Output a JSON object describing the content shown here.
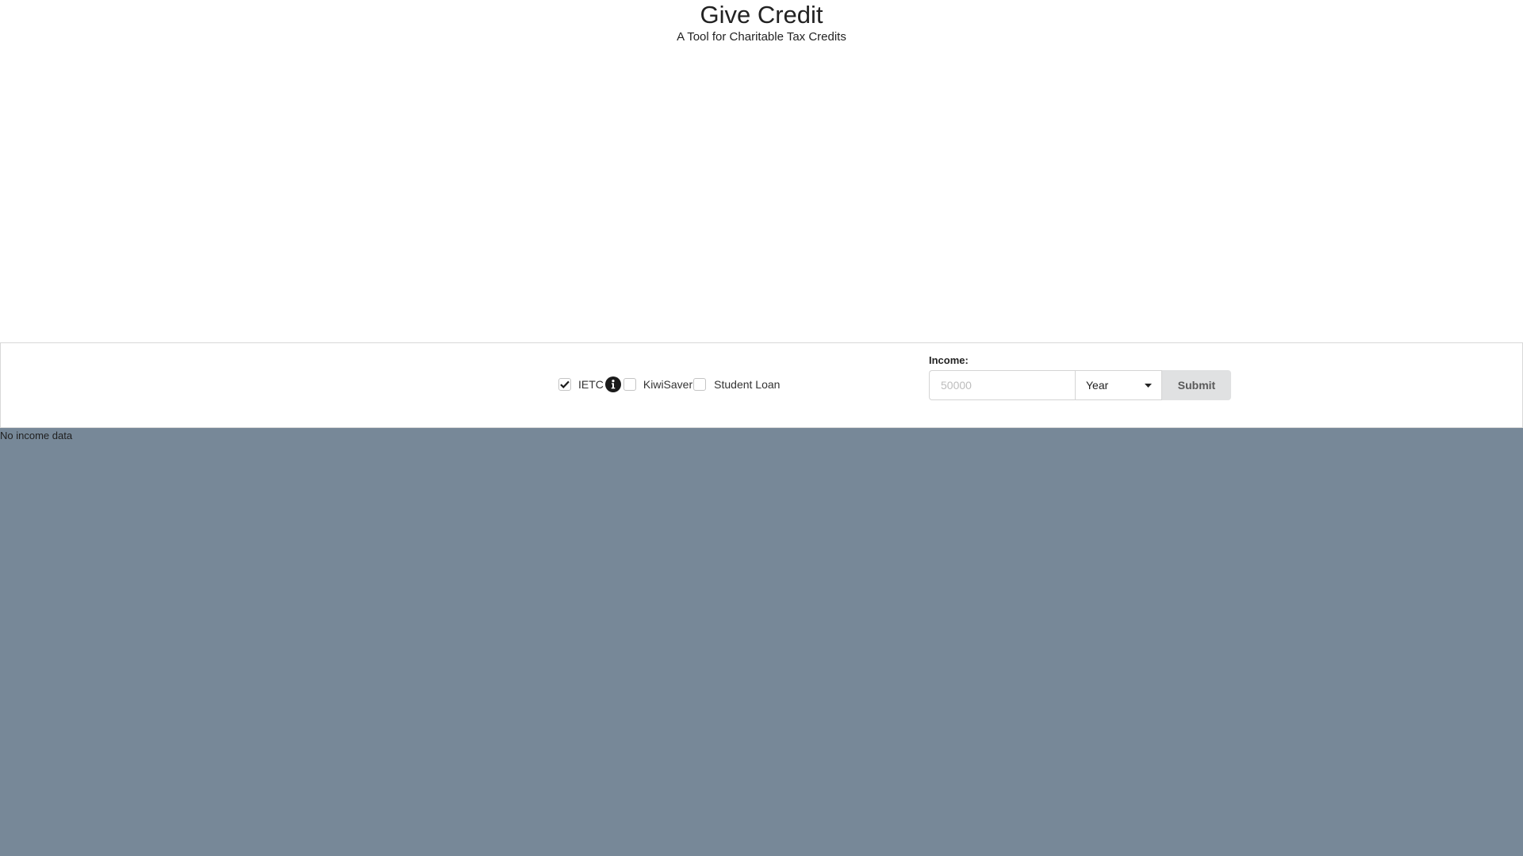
{
  "header": {
    "title": "Give Credit",
    "subtitle": "A Tool for Charitable Tax Credits"
  },
  "options": {
    "ietc": {
      "label": "IETC",
      "checked": true,
      "info_icon": "info-icon"
    },
    "kiwisaver": {
      "label": "KiwiSaver",
      "checked": false
    },
    "student_loan": {
      "label": "Student Loan",
      "checked": false
    }
  },
  "income": {
    "label": "Income:",
    "placeholder": "50000",
    "value": "",
    "period": "Year",
    "submit_label": "Submit"
  },
  "results": {
    "empty_message": "No income data"
  },
  "colors": {
    "results_background": "#778898",
    "submit_background": "#e0e1e2",
    "info_icon_background": "#1b1b1b"
  }
}
